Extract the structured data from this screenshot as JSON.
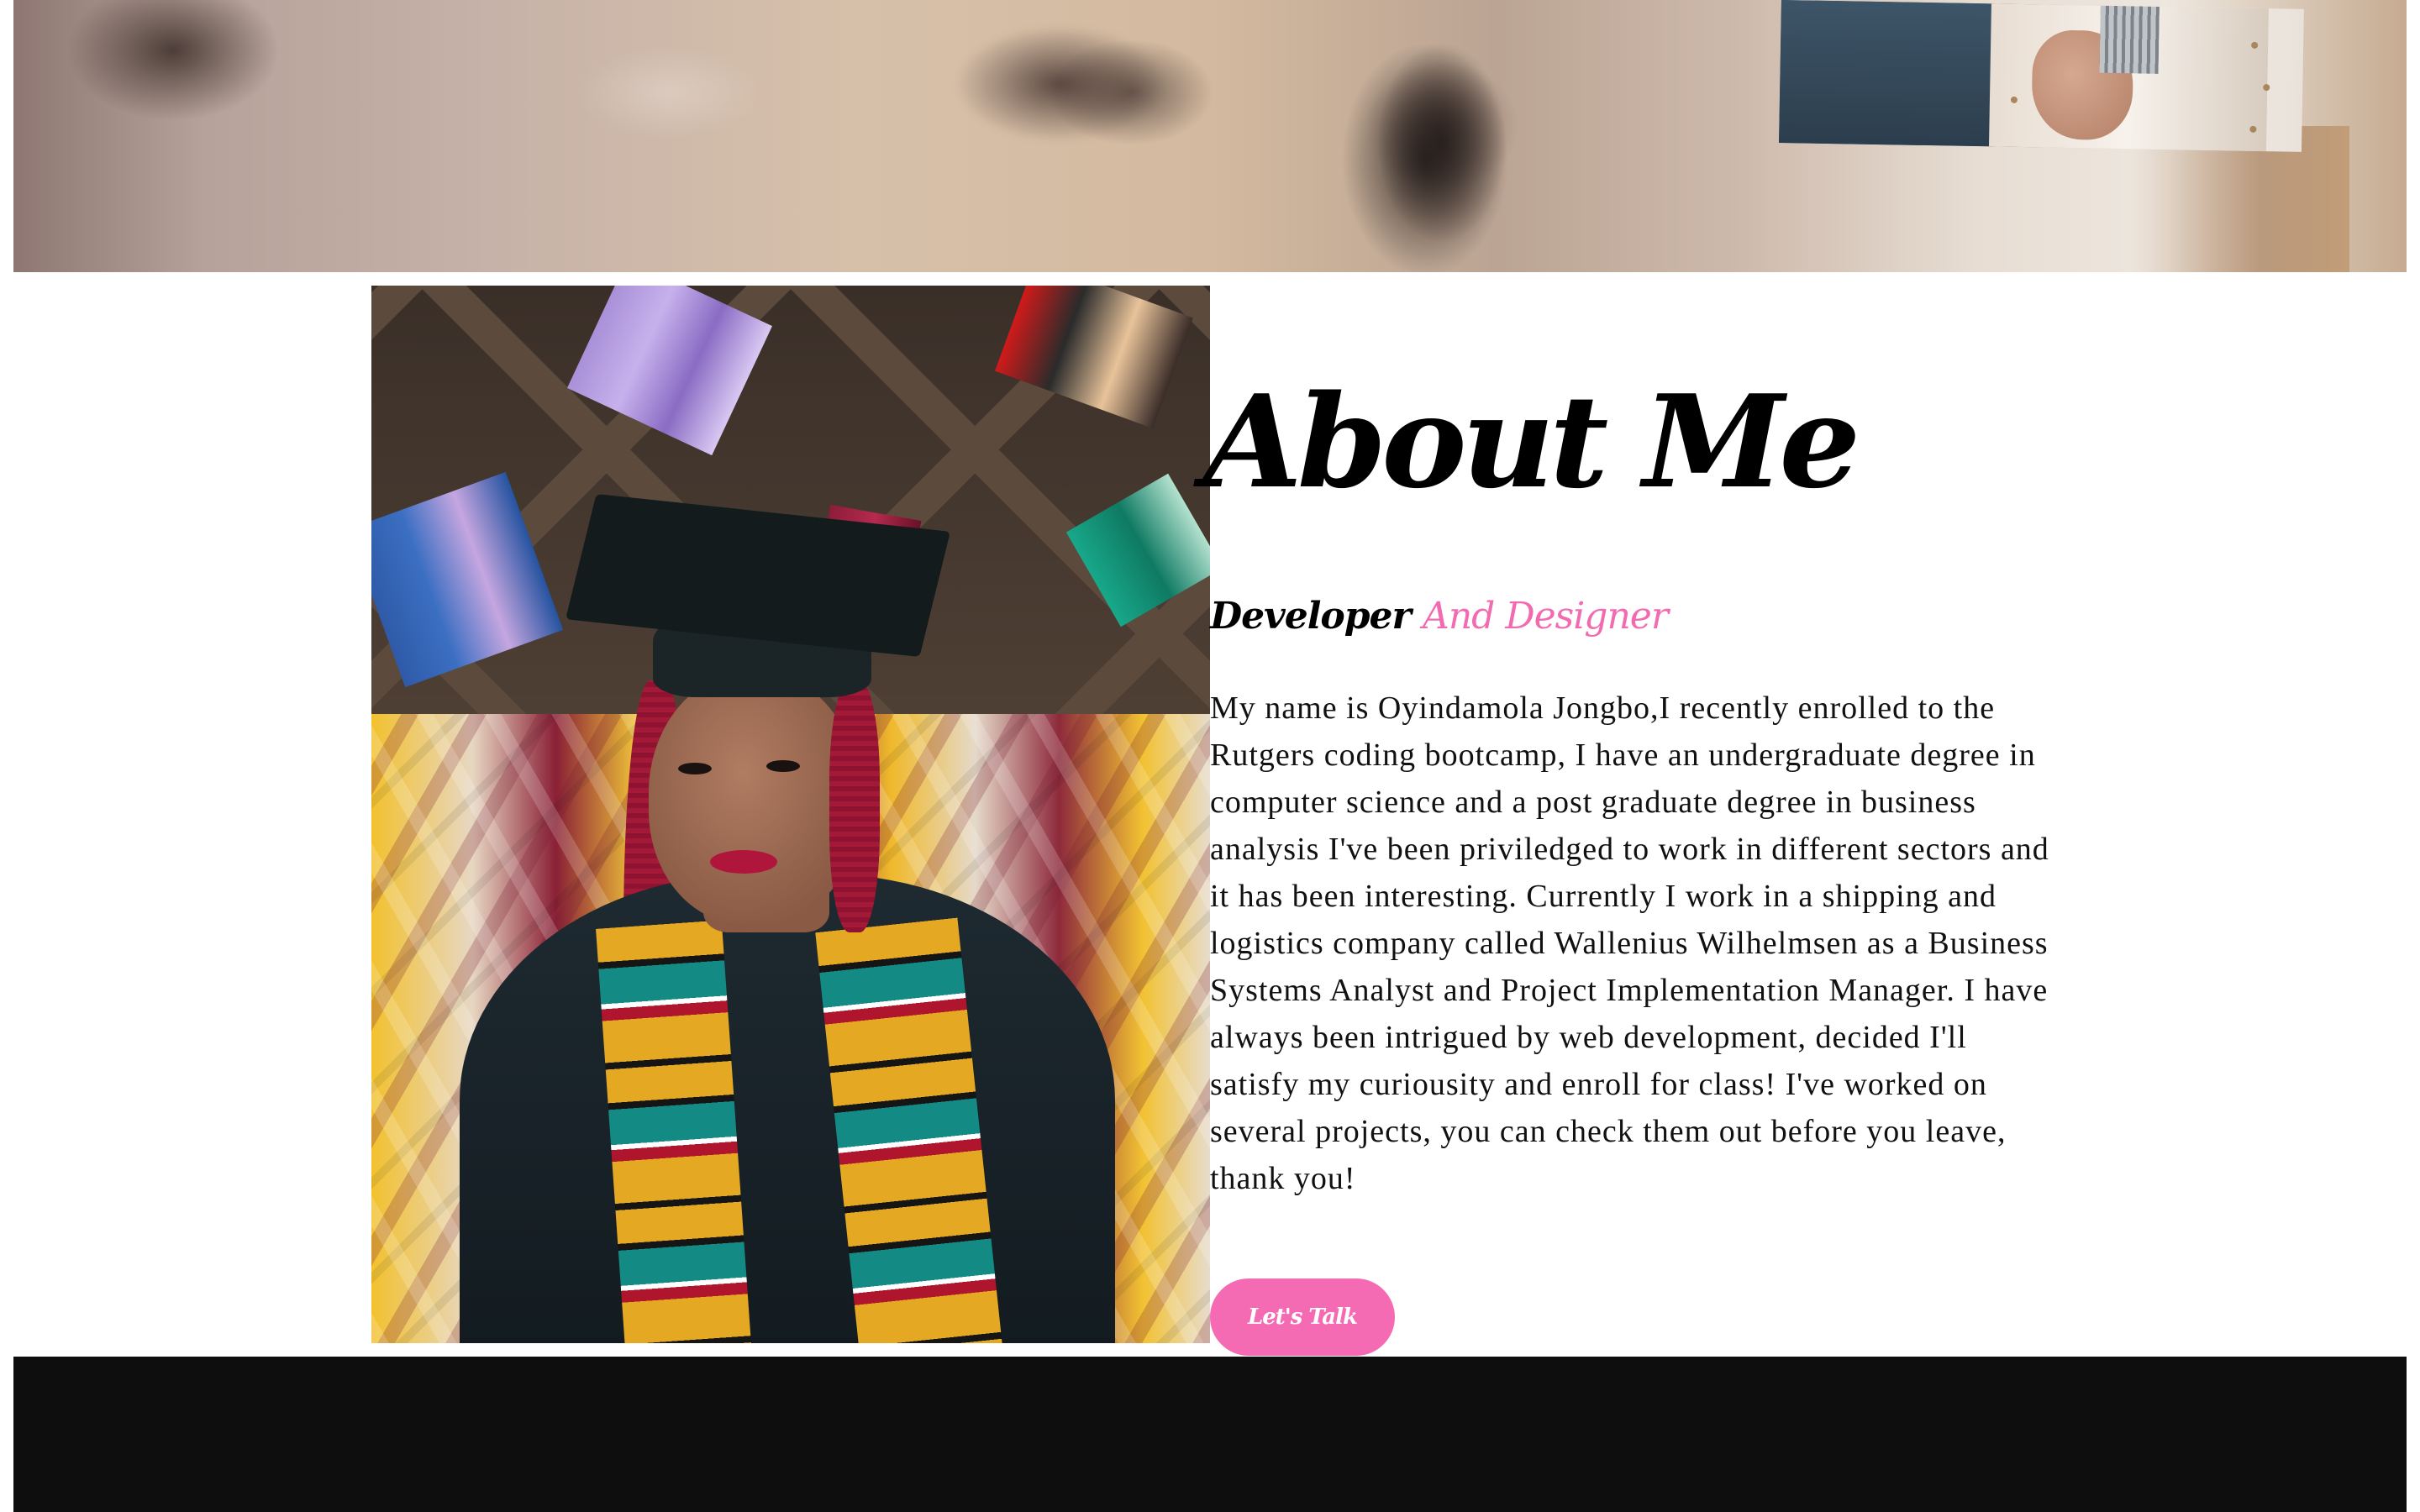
{
  "hero": {
    "image_alt": "blurred banner photo"
  },
  "about": {
    "title": "About Me",
    "subtitle_primary": "Developer",
    "subtitle_accent": "And Designer",
    "bio": "My name is Oyindamola Jongbo,I recently enrolled to the Rutgers coding bootcamp, I have an undergraduate degree in computer science and a post graduate degree in business analysis I've been priviledged to work in different sectors and it has been interesting. Currently I work in a shipping and logistics company called Wallenius Wilhelmsen as a Business Systems Analyst and Project Implementation Manager. I have always been intrigued by web development, decided I'll satisfy my curiousity and enroll for class! I've worked on several projects, you can check them out before you leave, thank you!",
    "cta_label": "Let's Talk"
  },
  "colors": {
    "accent": "#f46bb4",
    "text": "#000000",
    "footer_bg": "#0e0e0e"
  }
}
